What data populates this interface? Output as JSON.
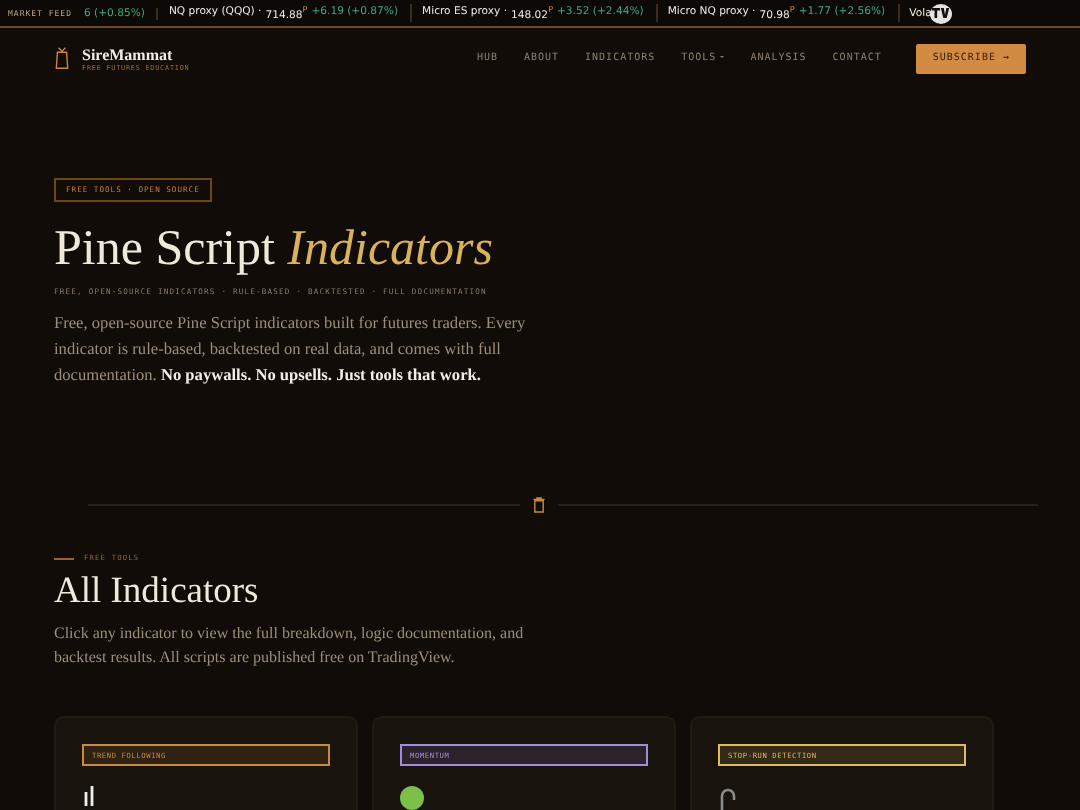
{
  "ticker": {
    "label": "MARKET FEED",
    "items": [
      {
        "change": "6 (+0.85%)"
      },
      {
        "name": "NQ proxy (QQQ) ·",
        "price": "714.88$^{P}$",
        "change": "+6.19 (+0.87%)"
      },
      {
        "name": "Micro ES proxy ·",
        "price": "148.02$^{P}$",
        "change": "+3.52 (+2.44%)"
      },
      {
        "name": "Micro NQ proxy ·",
        "price": "70.98$^{P}$",
        "change": "+1.77 (+2.56%)"
      },
      {
        "name": "Vola"
      }
    ]
  },
  "nav": {
    "brand": "SireMammat",
    "tagline": "FREE FUTURES EDUCATION",
    "links": [
      {
        "label": "HUB",
        "dropdown": false
      },
      {
        "label": "ABOUT",
        "dropdown": false
      },
      {
        "label": "INDICATORS",
        "dropdown": false
      },
      {
        "label": "TOOLS",
        "dropdown": true
      },
      {
        "label": "ANALYSIS",
        "dropdown": false
      },
      {
        "label": "CONTACT",
        "dropdown": false
      }
    ],
    "cta": "SUBSCRIBE →"
  },
  "hero": {
    "tag": "FREE TOOLS · OPEN SOURCE",
    "title": "Pine Script",
    "title_accent": "Indicators",
    "subtitle": "FREE, OPEN-SOURCE INDICATORS · RULE-BASED · BACKTESTED · FULL DOCUMENTATION",
    "text": "Free, open-source Pine Script indicators built for futures traders. Every indicator is rule-based, backtested on real data, and comes with full documentation. **No paywalls. No upsells. Just tools that work.**"
  },
  "section": {
    "eyebrow": "FREE TOOLS",
    "title": "All Indicators",
    "text": "Click any indicator to view the full breakdown, logic documentation, and backtest results. All scripts are published free on TradingView."
  },
  "cards": [
    {
      "tag": "TREND FOLLOWING",
      "color": "#c98a3c",
      "kind": "bars"
    },
    {
      "tag": "MOMENTUM",
      "color": "#a58be0",
      "kind": "dot"
    },
    {
      "tag": "STOP-RUN DETECTION",
      "color": "#e0bc5a",
      "kind": "hook"
    }
  ]
}
